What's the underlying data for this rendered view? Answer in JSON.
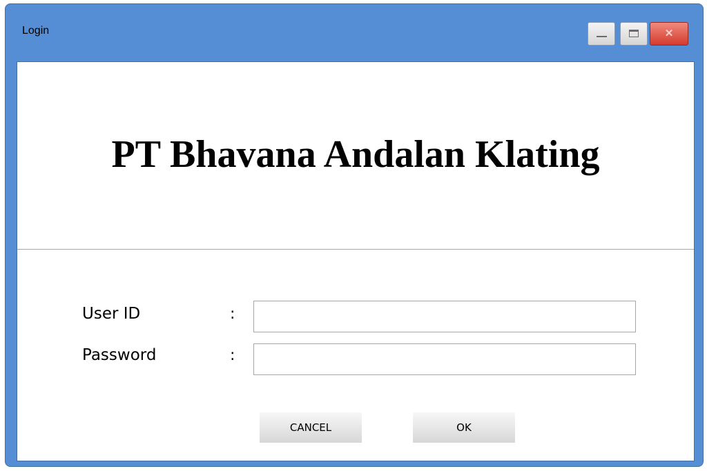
{
  "window": {
    "title": "Login",
    "controls": {
      "minimize_icon": "minimize-icon",
      "maximize_icon": "maximize-icon",
      "close_icon": "close-icon",
      "close_glyph": "✕"
    }
  },
  "header": {
    "company_name": "PT Bhavana Andalan Klating"
  },
  "form": {
    "user_id": {
      "label": "User ID",
      "colon": ":",
      "value": ""
    },
    "password": {
      "label": "Password",
      "colon": ":",
      "value": ""
    }
  },
  "actions": {
    "cancel_label": "CANCEL",
    "ok_label": "OK"
  },
  "colors": {
    "titlebar": "#558ed5",
    "close_button": "#d33b2d",
    "button_face": "#e6e6e6"
  }
}
